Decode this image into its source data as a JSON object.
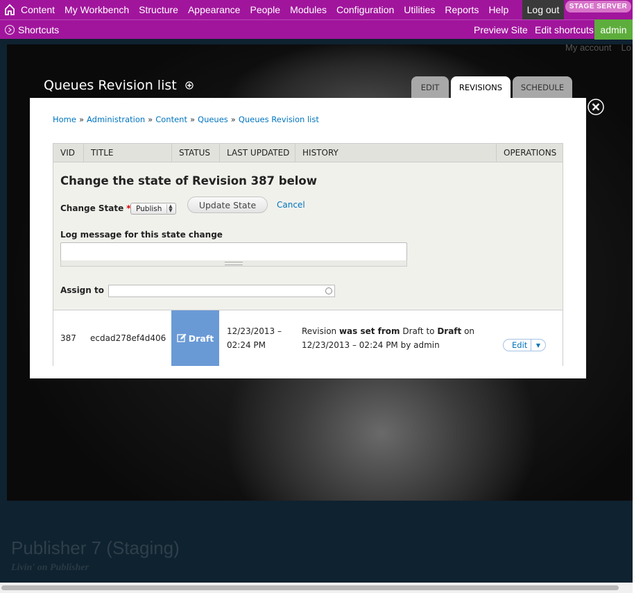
{
  "toolbar": {
    "menu": [
      "Content",
      "My Workbench",
      "Structure",
      "Appearance",
      "People",
      "Modules",
      "Configuration",
      "Utilities",
      "Reports",
      "Help"
    ],
    "logout": "Log out",
    "stage_badge": "STAGE SERVER"
  },
  "shortcuts": {
    "label": "Shortcuts",
    "preview_site": "Preview Site",
    "edit_shortcuts": "Edit shortcuts",
    "user": "admin"
  },
  "user_actions": [
    "My account",
    "Lo"
  ],
  "overlay": {
    "title": "Queues Revision list",
    "tabs": [
      "EDIT",
      "REVISIONS",
      "SCHEDULE"
    ],
    "active_tab": "REVISIONS"
  },
  "breadcrumb": [
    "Home",
    "Administration",
    "Content",
    "Queues",
    "Queues Revision list"
  ],
  "breadcrumb_sep": "»",
  "table": {
    "headers": [
      "VID",
      "TITLE",
      "STATUS",
      "LAST UPDATED",
      "HISTORY",
      "OPERATIONS"
    ]
  },
  "form": {
    "title": "Change the state of Revision 387 below",
    "change_state_label": "Change State",
    "required_marker": "*",
    "state_value": "Publish",
    "update_button": "Update State",
    "cancel": "Cancel",
    "log_label": "Log message for this state change",
    "log_value": "",
    "assign_label": "Assign to",
    "assign_value": ""
  },
  "revision": {
    "vid": "387",
    "title": "ecdad278ef4d406",
    "status": "Draft",
    "last_updated_date": "12/23/2013 –",
    "last_updated_time": "02:24 PM",
    "history_1a": "Revision ",
    "history_1b": "was set from",
    "history_1c": " Draft to ",
    "history_1d": "Draft",
    "history_1e": " on",
    "history_2": "12/23/2013 – 02:24 PM by admin",
    "edit": "Edit"
  },
  "site": {
    "name": "Publisher 7 (Staging)",
    "slogan": "Livin' on Publisher"
  },
  "colors": {
    "toolbar": "#a1159c",
    "admin_tab": "#5dad3c",
    "status_draft": "#6a9ad6",
    "link": "#0074bd"
  }
}
